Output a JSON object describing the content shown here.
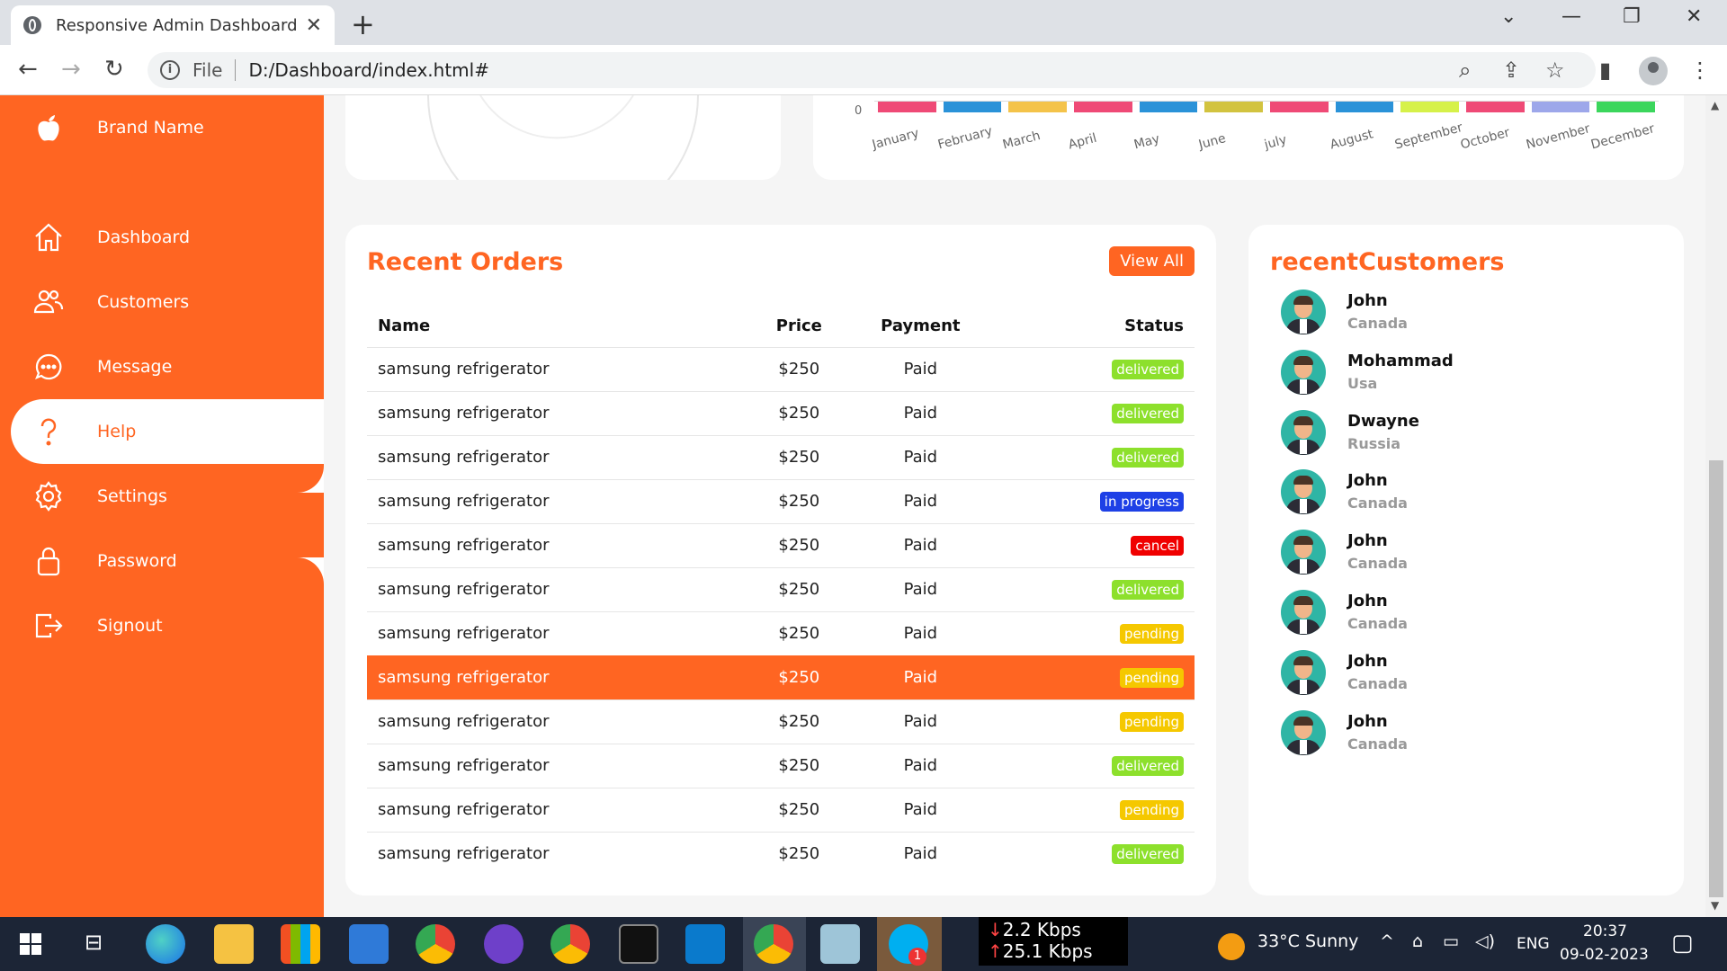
{
  "browser": {
    "tab_title": "Responsive Admin Dashboard",
    "file_label": "File",
    "url": "D:/Dashboard/index.html#"
  },
  "brand": {
    "name": "Brand Name"
  },
  "nav": [
    {
      "label": "Dashboard",
      "icon": "home-icon"
    },
    {
      "label": "Customers",
      "icon": "people-icon"
    },
    {
      "label": "Message",
      "icon": "chat-icon"
    },
    {
      "label": "Help",
      "icon": "help-icon",
      "active": true
    },
    {
      "label": "Settings",
      "icon": "gear-icon"
    },
    {
      "label": "Password",
      "icon": "lock-icon"
    },
    {
      "label": "Signout",
      "icon": "signout-icon"
    }
  ],
  "chart": {
    "zero_label": "0",
    "months": [
      "January",
      "February",
      "March",
      "April",
      "May",
      "June",
      "july",
      "August",
      "September",
      "October",
      "November",
      "December"
    ],
    "colors": [
      "#ef4a76",
      "#2a92d8",
      "#f4c34a",
      "#ef4a76",
      "#2a92d8",
      "#d2c33f",
      "#ef4a76",
      "#2a92d8",
      "#d6f14a",
      "#ef4a76",
      "#9da7ea",
      "#3bd65c"
    ]
  },
  "orders": {
    "title": "Recent Orders",
    "view_all": "View All",
    "headers": {
      "name": "Name",
      "price": "Price",
      "payment": "Payment",
      "status": "Status"
    },
    "rows": [
      {
        "name": "samsung refrigerator",
        "price": "$250",
        "payment": "Paid",
        "status": "delivered"
      },
      {
        "name": "samsung refrigerator",
        "price": "$250",
        "payment": "Paid",
        "status": "delivered"
      },
      {
        "name": "samsung refrigerator",
        "price": "$250",
        "payment": "Paid",
        "status": "delivered"
      },
      {
        "name": "samsung refrigerator",
        "price": "$250",
        "payment": "Paid",
        "status": "in progress"
      },
      {
        "name": "samsung refrigerator",
        "price": "$250",
        "payment": "Paid",
        "status": "cancel"
      },
      {
        "name": "samsung refrigerator",
        "price": "$250",
        "payment": "Paid",
        "status": "delivered"
      },
      {
        "name": "samsung refrigerator",
        "price": "$250",
        "payment": "Paid",
        "status": "pending"
      },
      {
        "name": "samsung refrigerator",
        "price": "$250",
        "payment": "Paid",
        "status": "pending",
        "highlighted": true
      },
      {
        "name": "samsung refrigerator",
        "price": "$250",
        "payment": "Paid",
        "status": "pending"
      },
      {
        "name": "samsung refrigerator",
        "price": "$250",
        "payment": "Paid",
        "status": "delivered"
      },
      {
        "name": "samsung refrigerator",
        "price": "$250",
        "payment": "Paid",
        "status": "pending"
      },
      {
        "name": "samsung refrigerator",
        "price": "$250",
        "payment": "Paid",
        "status": "delivered"
      }
    ],
    "status_colors": {
      "delivered": "#8de02c",
      "in progress": "#1e40e6",
      "cancel": "#f00000",
      "pending": "#f5c800"
    }
  },
  "customers": {
    "title": "recentCustomers",
    "items": [
      {
        "name": "John",
        "country": "Canada"
      },
      {
        "name": "Mohammad",
        "country": "Usa"
      },
      {
        "name": "Dwayne",
        "country": "Russia"
      },
      {
        "name": "John",
        "country": "Canada"
      },
      {
        "name": "John",
        "country": "Canada"
      },
      {
        "name": "John",
        "country": "Canada"
      },
      {
        "name": "John",
        "country": "Canada"
      },
      {
        "name": "John",
        "country": "Canada"
      }
    ]
  },
  "taskbar": {
    "net_down": "2.2 Kbps",
    "net_up": "25.1 Kbps",
    "weather": "33°C  Sunny",
    "lang": "ENG",
    "time": "20:37",
    "date": "09-02-2023",
    "skype_badge": "1"
  },
  "accent_color": "#ff6522"
}
